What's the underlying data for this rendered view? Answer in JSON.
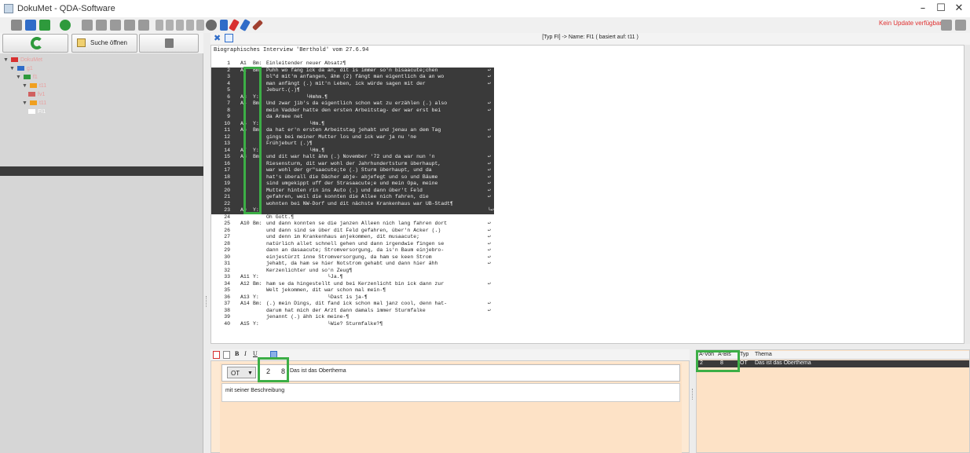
{
  "window": {
    "title": "DokuMet - QDA-Software",
    "minimize": "–",
    "maximize": "☐",
    "close": "✕"
  },
  "toolbar": {
    "update_status": "Kein Update verfügbar",
    "colors": {
      "green": "#2e9a3c",
      "blue": "#2f6cc8",
      "gray": "#8a8a8a",
      "orange": "#f0a020",
      "red": "#d83030",
      "pink": "#e040a0"
    }
  },
  "left_panel": {
    "refresh_icon": "refresh-icon",
    "search_button_label": "Suche öffnen",
    "tree": [
      {
        "label": "DokuMet",
        "icon_color": "#d83030",
        "level": 0,
        "arrow": "▼"
      },
      {
        "label": "g1",
        "icon_color": "#2f6cc8",
        "level": 1,
        "arrow": "▼"
      },
      {
        "label": "f1",
        "icon_color": "#2e9a3c",
        "level": 2,
        "arrow": "▼"
      },
      {
        "label": "t11",
        "icon_color": "#f0a020",
        "level": 3,
        "arrow": "▼"
      },
      {
        "label": "fv1",
        "icon_color": "#d06060",
        "level": 4,
        "arrow": ""
      },
      {
        "label": "t11",
        "icon_color": "#f0a020",
        "level": 3,
        "arrow": "▼"
      },
      {
        "label": "FI1",
        "icon_color": "#ffffff",
        "level": 4,
        "arrow": "",
        "selected": true
      }
    ]
  },
  "editor": {
    "title": "[Typ FI] -> Name: FI1 ( basiert auf: t11 )",
    "heading": "Biographisches Interview 'Berthold' vom 27.6.94",
    "lines": [
      {
        "n": "1",
        "aid": "A1",
        "spk": "Bm:",
        "txt": "Einleitender neuer Absatz¶",
        "hi": false
      },
      {
        "n": "2",
        "aid": "A2",
        "spk": "Bm:",
        "txt": "Puhh wo fang ick da an, dit is immer so'n bisaacute;chen",
        "hi": true,
        "mark": "↩"
      },
      {
        "n": "3",
        "aid": "",
        "spk": "",
        "txt": "bl\"d mit'm anfangen, ähm (2) fängt man eigentlich da an wo",
        "hi": true,
        "mark": "↩"
      },
      {
        "n": "4",
        "aid": "",
        "spk": "",
        "txt": "man anfängt (.) mit'n Leben, ick würde sagen mit der",
        "hi": true,
        "mark": "↩"
      },
      {
        "n": "5",
        "aid": "",
        "spk": "",
        "txt": "Jeburt.(.)¶",
        "hi": true
      },
      {
        "n": "6",
        "aid": "A3",
        "spk": "Y:",
        "txt": "             └Hmhm.¶",
        "hi": true
      },
      {
        "n": "7",
        "aid": "A4",
        "spk": "Bm:",
        "txt": "Und zwar jib's da eigentlich schon wat zu erzählen (.) also",
        "hi": true,
        "mark": "↩"
      },
      {
        "n": "8",
        "aid": "",
        "spk": "",
        "txt": "mein Vadder hatte den ersten Arbeitstag- der war erst bei",
        "hi": true,
        "mark": "↩"
      },
      {
        "n": "9",
        "aid": "",
        "spk": "",
        "txt": "da Armee net",
        "hi": true
      },
      {
        "n": "10",
        "aid": "A5",
        "spk": "Y:",
        "txt": "              └Hm.¶",
        "hi": true
      },
      {
        "n": "11",
        "aid": "A6",
        "spk": "Bm:",
        "txt": "da hat er'n ersten Arbeitstag jehabt und jenau an dem Tag",
        "hi": true,
        "mark": "↩"
      },
      {
        "n": "12",
        "aid": "",
        "spk": "",
        "txt": "gings bei meiner Mutter los und ick war ja nu 'ne",
        "hi": true,
        "mark": "↩"
      },
      {
        "n": "13",
        "aid": "",
        "spk": "",
        "txt": "Frühjeburt (.)¶",
        "hi": true
      },
      {
        "n": "14",
        "aid": "A7",
        "spk": "Y:",
        "txt": "              └Hm.¶",
        "hi": true
      },
      {
        "n": "15",
        "aid": "A8",
        "spk": "Bm:",
        "txt": "und dit war halt ähm (.) November '72 und da war nun 'n",
        "hi": true,
        "mark": "↩"
      },
      {
        "n": "16",
        "aid": "",
        "spk": "",
        "txt": "Riesensturm, dit war wohl der Jahrhundertsturm überhaupt,",
        "hi": true,
        "mark": "↩"
      },
      {
        "n": "17",
        "aid": "",
        "spk": "",
        "txt": "war wohl der gr\"saacute;te (.) Sturm überhaupt, und da",
        "hi": true,
        "mark": "↩"
      },
      {
        "n": "18",
        "aid": "",
        "spk": "",
        "txt": "hat's überall die Dächer abje- abjefegt und so und Bäume",
        "hi": true,
        "mark": "↩"
      },
      {
        "n": "19",
        "aid": "",
        "spk": "",
        "txt": "sind umgekippt uff der Strasaacute;e und mein Opa, meine",
        "hi": true,
        "mark": "↩"
      },
      {
        "n": "20",
        "aid": "",
        "spk": "",
        "txt": "Mutter hinten rin ins Auto (.) und dann über't Feld",
        "hi": true,
        "mark": "↩"
      },
      {
        "n": "21",
        "aid": "",
        "spk": "",
        "txt": "gefahren, weil die konnten die Allee nich fahren, die",
        "hi": true,
        "mark": "↩"
      },
      {
        "n": "22",
        "aid": "",
        "spk": "",
        "txt": "wohnten bei NW-Dorf und dit nächste Krankenhaus war UB-Stadt¶",
        "hi": true
      },
      {
        "n": "23",
        "aid": "A9",
        "spk": "Y:",
        "txt": "",
        "hi": true,
        "mark": "└↩"
      },
      {
        "n": "24",
        "aid": "",
        "spk": "",
        "txt": "Oh Gott.¶",
        "hi": false
      },
      {
        "n": "25",
        "aid": "A10",
        "spk": "Bm:",
        "txt": "und dann konnten se die janzen Alleen nich lang fahren dort",
        "hi": false,
        "mark": "↩"
      },
      {
        "n": "26",
        "aid": "",
        "spk": "",
        "txt": "und dann sind se über dit Feld gefahren, über'n Acker (.)",
        "hi": false,
        "mark": "↩"
      },
      {
        "n": "27",
        "aid": "",
        "spk": "",
        "txt": "und denn im Krankenhaus anjekommen, dit musaacute;",
        "hi": false,
        "mark": "↩"
      },
      {
        "n": "28",
        "aid": "",
        "spk": "",
        "txt": "natürlich allet schnell gehen und dann irgendwie fingen se",
        "hi": false,
        "mark": "↩"
      },
      {
        "n": "29",
        "aid": "",
        "spk": "",
        "txt": "dann an dasaacute; Stromversorgung, da is'n Baum einjebro-",
        "hi": false,
        "mark": "↩"
      },
      {
        "n": "30",
        "aid": "",
        "spk": "",
        "txt": "einjestürzt inne Stromversorgung, da ham se keen Strom",
        "hi": false,
        "mark": "↩"
      },
      {
        "n": "31",
        "aid": "",
        "spk": "",
        "txt": "jehabt, da ham se hier Notstrom gehabt und dann hier ähh",
        "hi": false,
        "mark": "↩"
      },
      {
        "n": "32",
        "aid": "",
        "spk": "",
        "txt": "Kerzenlichter und so'n Zeug¶",
        "hi": false
      },
      {
        "n": "33",
        "aid": "A11",
        "spk": "Y:",
        "txt": "                    └Ja.¶",
        "hi": false
      },
      {
        "n": "34",
        "aid": "A12",
        "spk": "Bm:",
        "txt": "ham se da hingestellt und bei Kerzenlicht bin ick dann zur",
        "hi": false,
        "mark": "↩"
      },
      {
        "n": "35",
        "aid": "",
        "spk": "",
        "txt": "Welt jekommen, dit war schon mal mein-¶",
        "hi": false
      },
      {
        "n": "36",
        "aid": "A13",
        "spk": "Y:",
        "txt": "                    └Dast is ja-¶",
        "hi": false
      },
      {
        "n": "37",
        "aid": "A14",
        "spk": "Bm:",
        "txt": "(.) mein Dings, dit fand ick schon mal janz cool, denn hat-",
        "hi": false,
        "mark": "↩"
      },
      {
        "n": "38",
        "aid": "",
        "spk": "",
        "txt": "darum hat mich der Arzt dann damals immer Sturmfalke",
        "hi": false,
        "mark": "↩"
      },
      {
        "n": "39",
        "aid": "",
        "spk": "",
        "txt": "jenannt (.) ähh ick meine-¶",
        "hi": false
      },
      {
        "n": "40",
        "aid": "A15",
        "spk": "Y:",
        "txt": "                    └Wie? Sturmfalke?¶",
        "hi": false
      }
    ]
  },
  "topic_editor": {
    "format_buttons": [
      "B",
      "I",
      "U"
    ],
    "type_value": "OT",
    "type_arrow": "▼",
    "a_von": "2",
    "a_bis": "8",
    "title": "Das ist das Oberthema",
    "description": "mit seiner Beschreibung"
  },
  "topics_table": {
    "columns": [
      "A-Von",
      "A-Bis",
      "Typ",
      "Thema"
    ],
    "rows": [
      {
        "a_von": "2",
        "a_bis": "8",
        "typ": "OT",
        "thema": "Das ist das Oberthema"
      }
    ]
  },
  "highlight_color": "#3cae46"
}
